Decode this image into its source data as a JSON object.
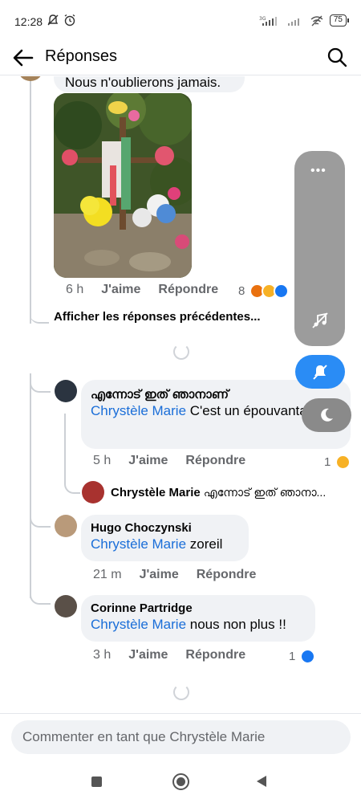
{
  "status_bar": {
    "time": "12:28",
    "battery": "75"
  },
  "header": {
    "title": "Réponses"
  },
  "top_comment": {
    "text_fragment": "Nous n'oublierons jamais.",
    "time": "6 h",
    "like_label": "J'aime",
    "reply_label": "Répondre",
    "reaction_count": "8"
  },
  "previous_replies_link": "Afficher les réponses précédentes...",
  "replies": [
    {
      "author": "എന്നോട് ഇത് ഞാനാണ്",
      "mention": "Chrystèle Marie",
      "text": " C'est un épouvantail ?",
      "time": "5 h",
      "like_label": "J'aime",
      "reply_label": "Répondre",
      "reaction_count": "1"
    },
    {
      "author": "Hugo Choczynski",
      "mention": "Chrystèle Marie",
      "text": " zoreil",
      "time": "21 m",
      "like_label": "J'aime",
      "reply_label": "Répondre"
    },
    {
      "author": "Corinne Partridge",
      "mention": "Chrystèle Marie",
      "text": " nous non plus !!",
      "time": "3 h",
      "like_label": "J'aime",
      "reply_label": "Répondre",
      "reaction_count": "1"
    }
  ],
  "nested_reply": {
    "author": "Chrystèle Marie",
    "preview": "എന്നോട് ഇത് ഞാനാ..."
  },
  "composer": {
    "placeholder": "Commenter en tant que Chrystèle Marie"
  },
  "floating_controls": {
    "dots": "•••"
  },
  "colors": {
    "mention": "#1a6ed8",
    "accent": "#2a8cf5",
    "meta": "#65676b",
    "bubble": "#f0f2f5"
  }
}
